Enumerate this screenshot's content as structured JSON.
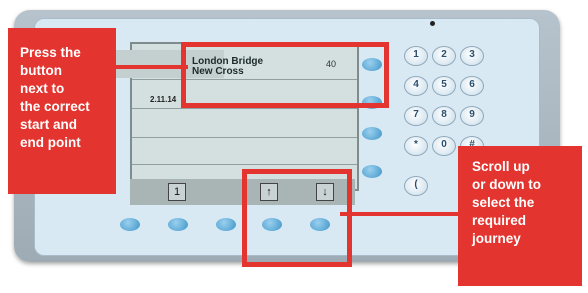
{
  "screen": {
    "route_start": "London Bridge",
    "route_end": "New Cross",
    "route_number": "40",
    "date_fragment": "2.11.14",
    "page_indicator": "1",
    "up_arrow": "↑",
    "down_arrow": "↓"
  },
  "keypad": {
    "keys": [
      "1",
      "2",
      "3",
      "4",
      "5",
      "6",
      "7",
      "8",
      "9",
      "*",
      "0",
      "#"
    ],
    "side_key": "("
  },
  "callouts": {
    "left": [
      "Press the",
      "button",
      "next to",
      "the correct",
      "start and",
      "end point"
    ],
    "right": [
      "Scroll up",
      "or down to",
      "select the",
      "required",
      "journey"
    ]
  },
  "colors": {
    "annotation_red": "#e3342f",
    "button_blue": "#3e95c9",
    "panel_bg": "#d9e9f4",
    "screen_bg": "#d3e0df"
  },
  "icons": [
    "camera-dot-icon",
    "up-arrow-icon",
    "down-arrow-icon"
  ]
}
